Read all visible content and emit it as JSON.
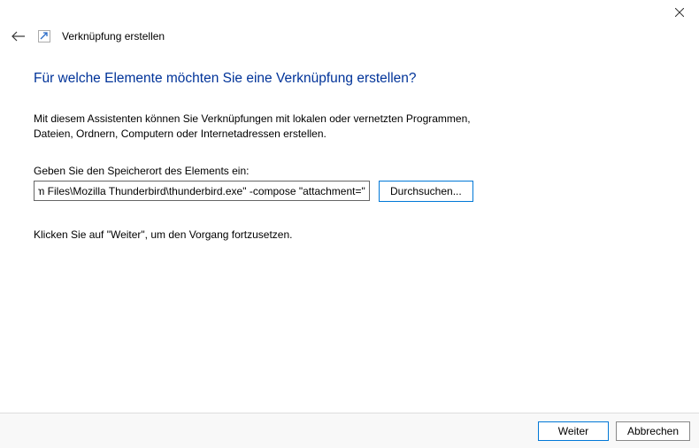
{
  "window": {
    "title": "Verknüpfung erstellen"
  },
  "heading": "Für welche Elemente möchten Sie eine Verknüpfung erstellen?",
  "description": "Mit diesem Assistenten können Sie Verknüpfungen mit lokalen oder vernetzten Programmen, Dateien, Ordnern, Computern oder Internetadressen erstellen.",
  "location": {
    "label": "Geben Sie den Speicherort des Elements ein:",
    "value": "gram Files\\Mozilla Thunderbird\\thunderbird.exe\" -compose \"attachment=\"",
    "browse_label": "Durchsuchen..."
  },
  "continue_hint": "Klicken Sie auf \"Weiter\", um den Vorgang fortzusetzen.",
  "footer": {
    "next_label": "Weiter",
    "cancel_label": "Abbrechen"
  }
}
